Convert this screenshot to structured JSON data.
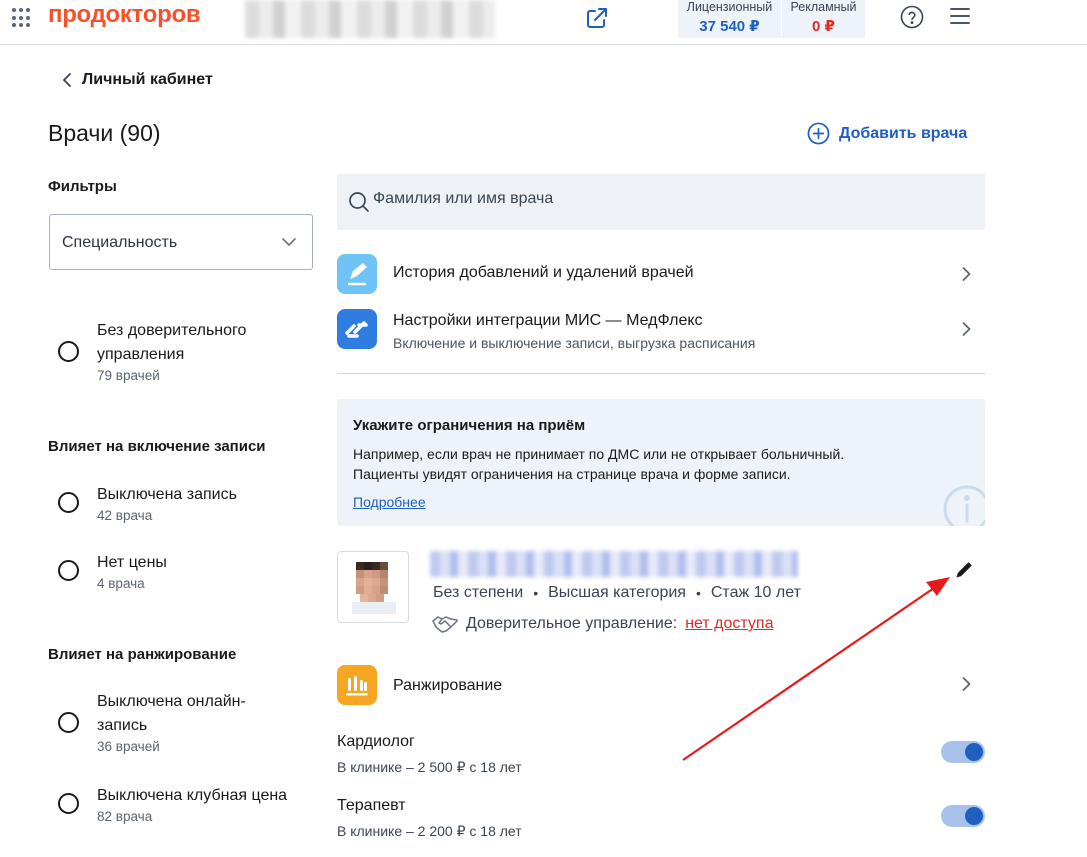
{
  "header": {
    "logo": "продокторов",
    "balances": [
      {
        "label": "Лицензионный",
        "value": "37 540 ₽"
      },
      {
        "label": "Рекламный",
        "value": "0 ₽"
      }
    ]
  },
  "nav": {
    "back_label": "Личный кабинет"
  },
  "page": {
    "title": "Врачи (90)",
    "add_label": "Добавить врача"
  },
  "filters": {
    "title": "Фильтры",
    "specialty_value": "Специальность",
    "trust": {
      "line1": "Без доверительного",
      "line2": "управления",
      "count": "79 врачей"
    },
    "group_booking": {
      "title": "Влияет на включение записи",
      "options": [
        {
          "label": "Выключена запись",
          "count": "42 врача"
        },
        {
          "label": "Нет цены",
          "count": "4 врача"
        }
      ]
    },
    "group_ranking": {
      "title": "Влияет на ранжирование",
      "options": [
        {
          "line1": "Выключена онлайн-",
          "line2": "запись",
          "count": "36 врачей"
        },
        {
          "label": "Выключена клубная цена",
          "count": "82 врача"
        }
      ]
    }
  },
  "search": {
    "placeholder": "Фамилия или имя врача"
  },
  "links": [
    {
      "title": "История добавлений и удалений врачей"
    },
    {
      "title": "Настройки интеграции МИС — МедФлекс",
      "subtitle": "Включение и выключение записи, выгрузка расписания"
    }
  ],
  "info_card": {
    "title": "Укажите ограничения на приём",
    "line1": "Например, если врач не принимает по ДМС или не открывает больничный.",
    "line2": "Пациенты увидят ограничения на странице врача и форме записи.",
    "more": "Подробнее"
  },
  "doctor": {
    "degree": "Без степени",
    "category": "Высшая категория",
    "experience": "Стаж 10 лет",
    "trust_label": "Доверительное управление:",
    "trust_status": "нет доступа",
    "ranking_label": "Ранжирование",
    "specialties": [
      {
        "name": "Кардиолог",
        "price": "В клинике – 2 500 ₽ с 18 лет",
        "enabled": true
      },
      {
        "name": "Терапевт",
        "price": "В клинике – 2 200 ₽ с 18 лет",
        "enabled": true
      }
    ]
  },
  "colors": {
    "brand": "#f4522d",
    "accent": "#1f5fbf",
    "danger": "#e02a24",
    "annotation_arrow": "#e8191b"
  }
}
